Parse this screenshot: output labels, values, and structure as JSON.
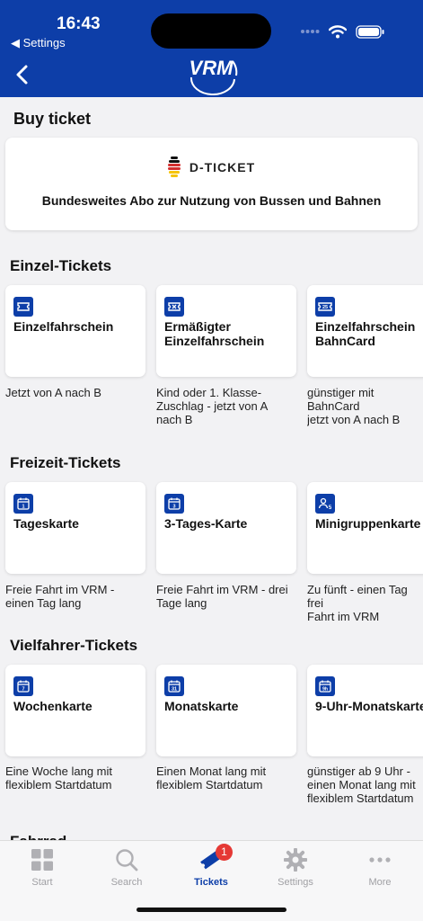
{
  "status": {
    "time": "16:43",
    "back_label": "◀ Settings"
  },
  "page": {
    "title": "Buy ticket"
  },
  "dticket": {
    "name": "D-TICKET",
    "description": "Bundesweites Abo zur Nutzung von Bussen und Bahnen"
  },
  "sections": [
    {
      "title": "Einzel-Tickets",
      "items": [
        {
          "title": "Einzelfahrschein",
          "desc": "Jetzt von A nach B",
          "icon": "ticket-icon"
        },
        {
          "title": "Ermäßigter\nEinzelfahrschein",
          "desc": "Kind oder 1. Klasse-\nZuschlag - jetzt von A\nnach B",
          "icon": "discount-ticket-icon"
        },
        {
          "title": "Einzelfahrschein\nBahnCard",
          "desc": "günstiger mit BahnCard\njetzt von A nach B",
          "icon": "bahncard-ticket-icon"
        }
      ]
    },
    {
      "title": "Freizeit-Tickets",
      "items": [
        {
          "title": "Tageskarte",
          "desc": "Freie Fahrt im VRM -\neinen Tag lang",
          "icon": "calendar-1-icon"
        },
        {
          "title": "3-Tages-Karte",
          "desc": "Freie Fahrt im VRM - drei\nTage lang",
          "icon": "calendar-3-icon"
        },
        {
          "title": "Minigruppenkarte",
          "desc": "Zu fünft - einen Tag frei\nFahrt im VRM",
          "icon": "group-icon"
        }
      ]
    },
    {
      "title": "Vielfahrer-Tickets",
      "items": [
        {
          "title": "Wochenkarte",
          "desc": "Eine Woche lang mit\nflexiblem Startdatum",
          "icon": "calendar-7-icon"
        },
        {
          "title": "Monatskarte",
          "desc": "Einen Monat lang mit\nflexiblem Startdatum",
          "icon": "calendar-31-icon"
        },
        {
          "title": "9-Uhr-Monatskarte",
          "desc": "günstiger ab 9 Uhr -\neinen Monat lang mit\nflexiblem Startdatum",
          "icon": "calendar-9h-icon"
        }
      ]
    },
    {
      "title": "Fahrrad",
      "items": []
    }
  ],
  "tabs": [
    {
      "label": "Start",
      "icon": "grid-icon"
    },
    {
      "label": "Search",
      "icon": "search-icon"
    },
    {
      "label": "Tickets",
      "icon": "tickets-icon",
      "badge": "1"
    },
    {
      "label": "Settings",
      "icon": "gear-icon"
    },
    {
      "label": "More",
      "icon": "more-icon"
    }
  ],
  "colors": {
    "brand": "#0d3ea8",
    "badge": "#e53935",
    "tab_inactive": "#a0a0a4"
  }
}
